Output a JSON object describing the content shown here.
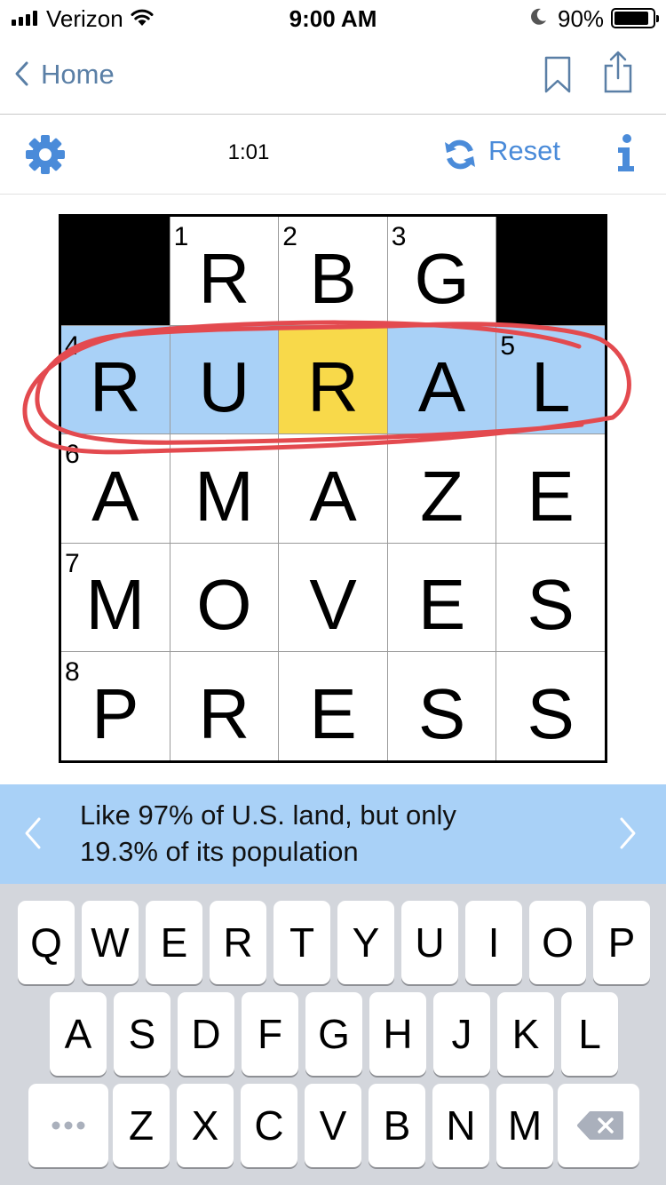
{
  "status_bar": {
    "carrier": "Verizon",
    "time": "9:00 AM",
    "battery_percent": "90%",
    "battery_level": 0.9
  },
  "nav": {
    "back_label": "Home",
    "back_icon": "chevron-left-icon",
    "bookmark_icon": "bookmark-icon",
    "share_icon": "share-icon"
  },
  "toolbar": {
    "settings_icon": "gear-icon",
    "timer": "1:01",
    "reset_label": "Reset",
    "info_icon": "info-icon"
  },
  "colors": {
    "accent_blue": "#4a8bd9",
    "nav_text": "#5a7fa6",
    "word_highlight": "#a9d1f7",
    "active_cell": "#f8d94a",
    "annotation_red": "#e34a4f"
  },
  "puzzle": {
    "rows": [
      [
        {
          "black": true
        },
        {
          "num": "1",
          "letter": "R"
        },
        {
          "num": "2",
          "letter": "B"
        },
        {
          "num": "3",
          "letter": "G"
        },
        {
          "black": true
        }
      ],
      [
        {
          "num": "4",
          "letter": "R",
          "word": true
        },
        {
          "letter": "U",
          "word": true
        },
        {
          "letter": "R",
          "word": true,
          "active": true
        },
        {
          "letter": "A",
          "word": true
        },
        {
          "num": "5",
          "letter": "L",
          "word": true
        }
      ],
      [
        {
          "num": "6",
          "letter": "A"
        },
        {
          "letter": "M"
        },
        {
          "letter": "A"
        },
        {
          "letter": "Z"
        },
        {
          "letter": "E"
        }
      ],
      [
        {
          "num": "7",
          "letter": "M"
        },
        {
          "letter": "O"
        },
        {
          "letter": "V"
        },
        {
          "letter": "E"
        },
        {
          "letter": "S"
        }
      ],
      [
        {
          "num": "8",
          "letter": "P"
        },
        {
          "letter": "R"
        },
        {
          "letter": "E"
        },
        {
          "letter": "S"
        },
        {
          "letter": "S"
        }
      ]
    ]
  },
  "clue": {
    "line1": "Like 97% of U.S. land, but only",
    "line2": "19.3% of its population"
  },
  "keyboard": {
    "row1": [
      "Q",
      "W",
      "E",
      "R",
      "T",
      "Y",
      "U",
      "I",
      "O",
      "P"
    ],
    "row2": [
      "A",
      "S",
      "D",
      "F",
      "G",
      "H",
      "J",
      "K",
      "L"
    ],
    "row3": [
      "Z",
      "X",
      "C",
      "V",
      "B",
      "N",
      "M"
    ],
    "more_icon": "more-dots-icon",
    "delete_icon": "backspace-icon"
  }
}
